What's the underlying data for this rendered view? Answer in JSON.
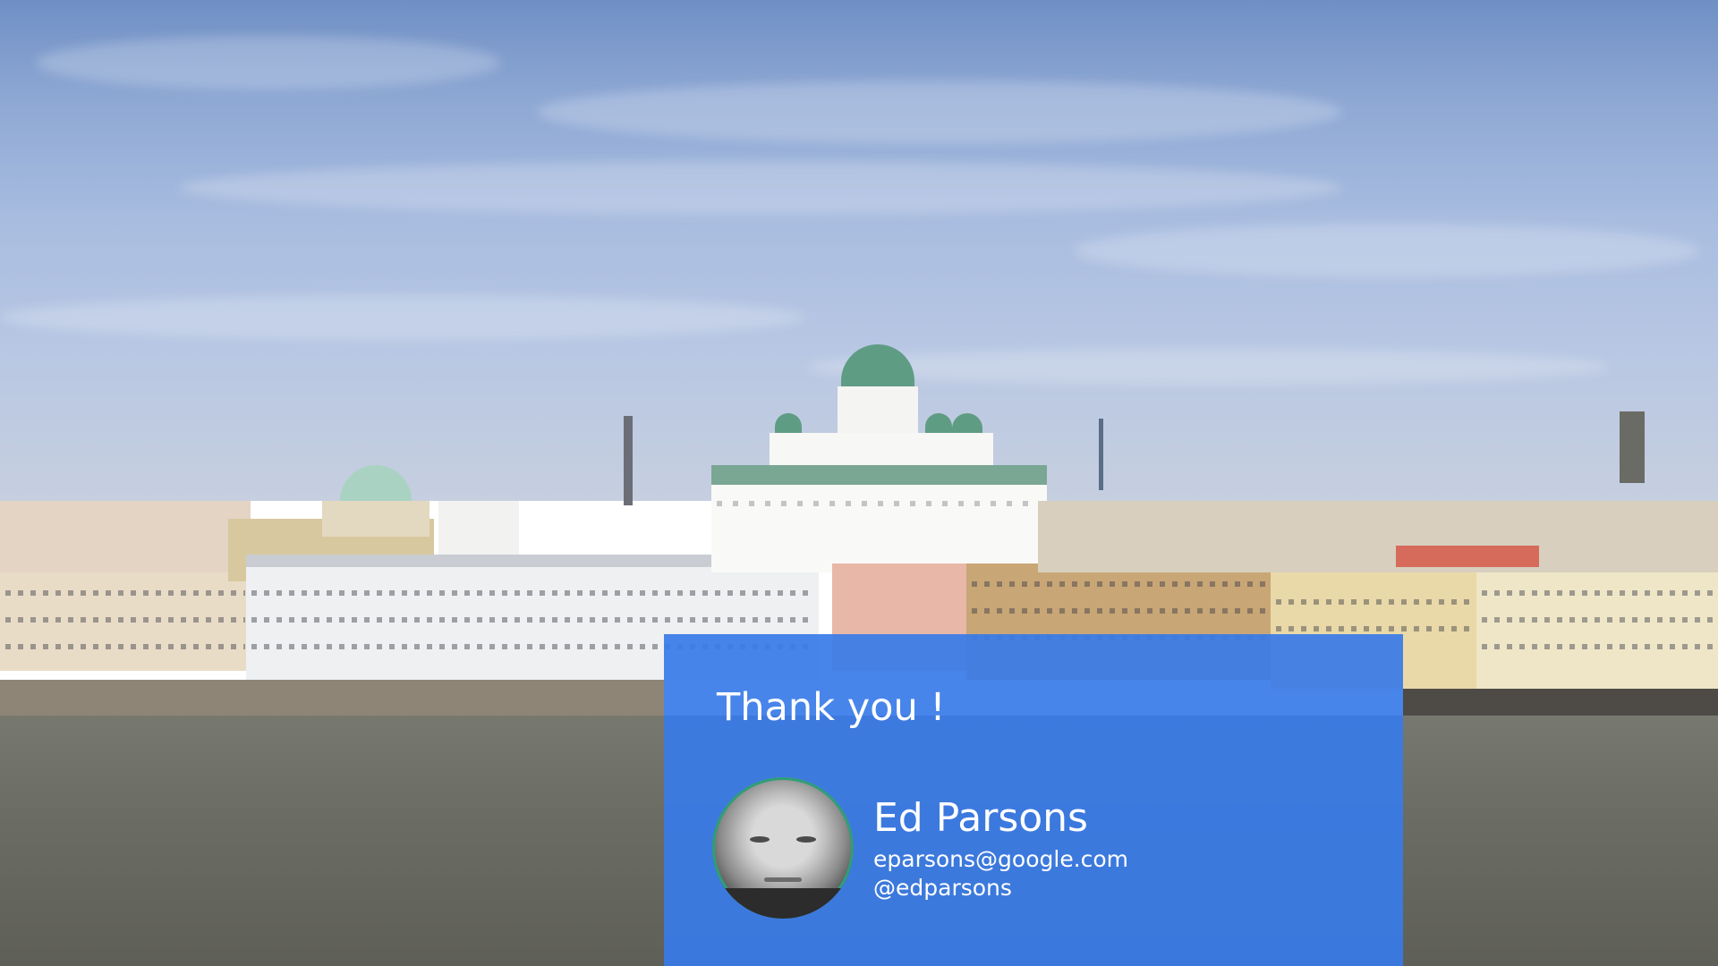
{
  "slide": {
    "background": "helsinki-waterfront-photo",
    "card": {
      "title": "Thank you !",
      "name": "Ed Parsons",
      "email": "eparsons@google.com",
      "handle": "@edparsons",
      "avatar": "ed-parsons-photo"
    },
    "colors": {
      "card": "#387be8",
      "text": "#ffffff"
    }
  }
}
